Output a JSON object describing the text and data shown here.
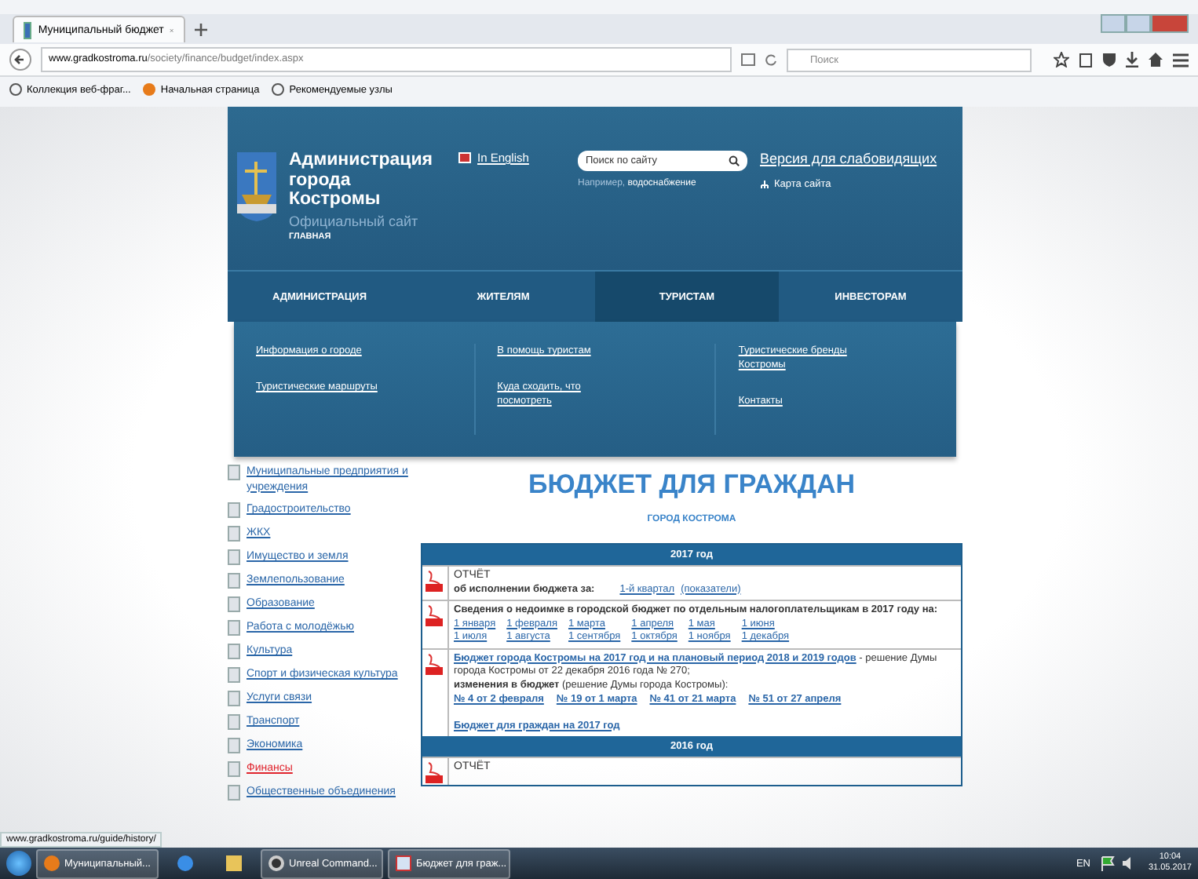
{
  "browser": {
    "tab_title": "Муниципальный бюджет",
    "url_host": "www.gradkostroma.ru",
    "url_path": "/society/finance/budget/index.aspx",
    "search_placeholder": "Поиск",
    "bookmarks": [
      {
        "label": "Коллекция веб-фраг...",
        "kind": "globe"
      },
      {
        "label": "Начальная страница",
        "kind": "firefox"
      },
      {
        "label": "Рекомендуемые узлы",
        "kind": "globe"
      }
    ]
  },
  "header": {
    "site_name": "Администрация города Костромы",
    "subtitle": "Официальный сайт",
    "breadcrumb": "ГЛАВНАЯ",
    "language_link": "In English",
    "search_placeholder": "Поиск по сайту",
    "hint_label": "Например,",
    "hint_link": "водоснабжение",
    "accessibility_link": "Версия для слабовидящих",
    "sitemap_link": "Карта сайта"
  },
  "nav": [
    {
      "label": "АДМИНИСТРАЦИЯ",
      "selected": false
    },
    {
      "label": "ЖИТЕЛЯМ",
      "selected": false
    },
    {
      "label": "ТУРИСТАМ",
      "selected": true
    },
    {
      "label": "ИНВЕСТОРАМ",
      "selected": false
    }
  ],
  "dropdown": [
    [
      "Информация о городе",
      "Туристические маршруты"
    ],
    [
      "В помощь туристам",
      "Куда сходить, что посмотреть"
    ],
    [
      "Туристические бренды Костромы",
      "Контакты"
    ]
  ],
  "sidebar": [
    {
      "label": "Муниципальные предприятия и учреждения",
      "selected": false
    },
    {
      "label": "Градостроительство",
      "selected": false
    },
    {
      "label": "ЖКХ",
      "selected": false
    },
    {
      "label": "Имущество и земля",
      "selected": false
    },
    {
      "label": "Землепользование",
      "selected": false
    },
    {
      "label": "Образование",
      "selected": false
    },
    {
      "label": "Работа с молодёжью",
      "selected": false
    },
    {
      "label": "Культура",
      "selected": false
    },
    {
      "label": "Спорт и физическая культура",
      "selected": false
    },
    {
      "label": "Услуги связи",
      "selected": false
    },
    {
      "label": "Транспорт",
      "selected": false
    },
    {
      "label": "Экономика",
      "selected": false
    },
    {
      "label": "Финансы",
      "selected": true
    },
    {
      "label": "Общественные объединения",
      "selected": false
    }
  ],
  "main": {
    "title": "БЮДЖЕТ ДЛЯ ГРАЖДАН",
    "subtitle": "ГОРОД КОСТРОМА",
    "sections": [
      {
        "year": "2017 год",
        "rows": [
          {
            "kind": "report",
            "heading": "ОТЧЁТ",
            "label": "об исполнении бюджета за:",
            "link": "1-й квартал",
            "paren_link": "(показатели)"
          },
          {
            "kind": "dates",
            "text": "Сведения о недоимке в городской бюджет по отдельным налогоплательщикам в 2017 году на:",
            "links": [
              "1 января",
              "1 февраля",
              "1 марта",
              "1 апреля",
              "1 мая",
              "1 июня",
              "1 июля",
              "1 августа",
              "1 сентября",
              "1 октября",
              "1 ноября",
              "1 декабря"
            ]
          },
          {
            "kind": "budget",
            "link": "Бюджет города Костромы на 2017 год и на плановый период 2018 и 2019 годов",
            "text": "- решение Думы города Костромы от 22 декабря 2016 года № 270;",
            "changes_bold": "изменения в бюджет",
            "changes_text": "(решение Думы города Костромы):",
            "links": [
              "№ 4 от 2 февраля",
              "№ 19 от 1 марта",
              "№ 41 от 21 марта",
              "№ 51 от 27 апреля"
            ],
            "footer_link": "Бюджет для граждан на 2017 год"
          }
        ]
      },
      {
        "year": "2016 год",
        "rows": [
          {
            "kind": "report",
            "heading": "ОТЧЁТ"
          }
        ]
      }
    ]
  },
  "status_url": "www.gradkostroma.ru/guide/history/",
  "taskbar": {
    "items": [
      {
        "kind": "start"
      },
      {
        "kind": "app",
        "label": "Муниципальный..."
      },
      {
        "kind": "icon"
      },
      {
        "kind": "icon"
      },
      {
        "kind": "app",
        "label": "Unreal Command..."
      },
      {
        "kind": "app",
        "label": "Бюджет для граж..."
      }
    ],
    "language": "EN",
    "time": "10:04",
    "date": "31.05.2017"
  }
}
